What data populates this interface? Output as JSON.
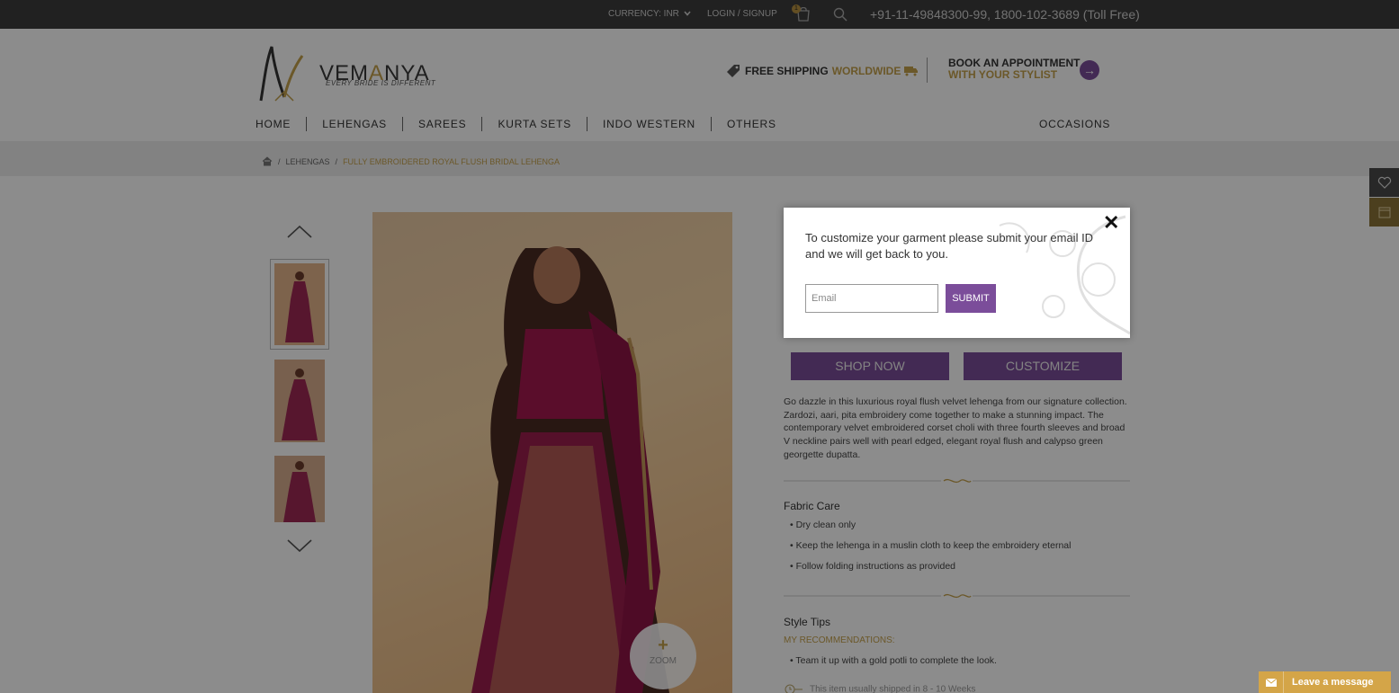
{
  "topbar": {
    "currency": "CURRENCY: INR",
    "login": "LOGIN / SIGNUP",
    "cart_count": "1",
    "phone": "+91-11-49848300-99, 1800-102-3689 (Toll Free)"
  },
  "header": {
    "logo_main_pre": "VEM",
    "logo_main_accent": "A",
    "logo_main_post": "NYA",
    "logo_tagline": "EVERY BRIDE IS DIFFERENT",
    "shipping_text": "FREE SHIPPING",
    "shipping_accent": "WORLDWIDE",
    "appointment_line1": "BOOK AN APPOINTMENT",
    "appointment_line2": "WITH YOUR STYLIST"
  },
  "nav": {
    "items": [
      "HOME",
      "LEHENGAS",
      "SAREES",
      "KURTA SETS",
      "INDO WESTERN",
      "OTHERS"
    ],
    "occasions": "OCCASIONS"
  },
  "breadcrumb": {
    "sep": "/",
    "category": "LEHENGAS",
    "current": "FULLY EMBROIDERED ROYAL FLUSH BRIDAL LEHENGA"
  },
  "gallery": {
    "zoom_label": "ZOOM"
  },
  "product": {
    "shop_now": "SHOP NOW",
    "customize": "CUSTOMIZE",
    "description": "Go dazzle in this luxurious royal flush velvet lehenga from our signature collection. Zardozi, aari, pita embroidery come together to make a stunning impact. The contemporary velvet embroidered corset choli with three fourth sleeves and broad V neckline pairs well with pearl edged, elegant royal flush and calypso green georgette dupatta.",
    "fabric_care_title": "Fabric Care",
    "fabric_care": [
      "Dry clean only",
      "Keep the lehenga in a muslin cloth to keep the embroidery eternal",
      "Follow folding instructions as provided"
    ],
    "style_tips_title": "Style Tips",
    "recommendations": "MY RECOMMENDATIONS:",
    "style_tips": [
      "Team it up with a gold potli to complete the look."
    ],
    "shipping_note": "This item usually shipped in 8 - 10 Weeks"
  },
  "modal": {
    "message": "To customize your garment please submit your email ID and we will get back to you.",
    "email_placeholder": "Email",
    "submit": "SUBMIT"
  },
  "chat": {
    "label": "Leave a message"
  },
  "colors": {
    "accent_gold": "#c4a04b",
    "brand_purple": "#7b4d9a",
    "topbar_bg": "#3d3d3d"
  }
}
